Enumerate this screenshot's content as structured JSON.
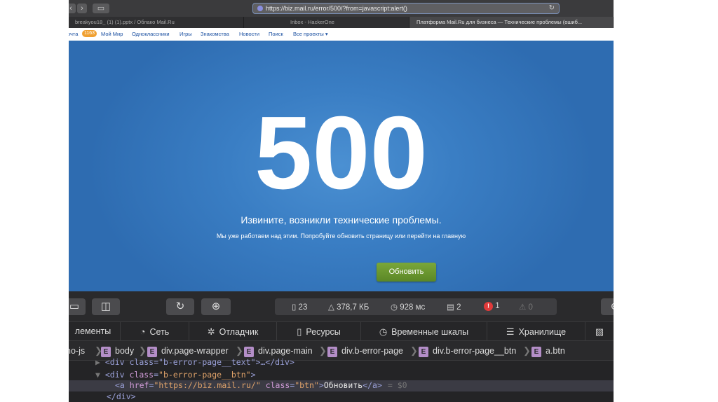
{
  "browser": {
    "url": "https://biz.mail.ru/error/500/?from=javascript:alert()",
    "tabs": [
      {
        "label": "breakyou18_ (1) (1).pptx / Облако Mail.Ru"
      },
      {
        "label": "Inbox - HackerOne"
      },
      {
        "label": "Платформа Mail.Ru для бизнеса — Технические проблемы (ошиб..."
      }
    ]
  },
  "portal_bar": {
    "mail_label": "очта",
    "mail_count": "1163",
    "links": [
      "Мой Мир",
      "Одноклассники",
      "Игры",
      "Знакомства",
      "Новости",
      "Поиск",
      "Все проекты ▾"
    ]
  },
  "error_page": {
    "code": "500",
    "headline": "Извините, возникли технические проблемы.",
    "subtext": "Мы уже работаем над этим. Попробуйте обновить страницу или перейти на главную",
    "button_label": "Обновить",
    "background_color": "#3a7ec4",
    "button_color": "#6b9a30"
  },
  "devtools": {
    "stats": {
      "resources": "23",
      "size": "378,7 КБ",
      "time": "928 мс",
      "logs": "2",
      "errors": "1",
      "warnings": "0"
    },
    "panel_tabs": [
      "лементы",
      "Сеть",
      "Отладчик",
      "Ресурсы",
      "Временные шкалы",
      "Хранилище"
    ],
    "breadcrumbs": [
      "no-js",
      "body",
      "div.page-wrapper",
      "div.page-main",
      "div.b-error-page",
      "div.b-error-page__btn",
      "a.btn"
    ],
    "dom": {
      "line1": "<div class=\"b-error-page__text\">…</div>",
      "line2_tag": "<div ",
      "line2_attr": "class",
      "line2_val": "\"b-error-page__btn\"",
      "line2_end": ">",
      "line3_open": "<a ",
      "line3_attr1": "href",
      "line3_val1": "\"https://biz.mail.ru/\"",
      "line3_attr2": "class",
      "line3_val2": "\"btn\"",
      "line3_text": "Обновить",
      "line3_close": "</a>",
      "line3_ref": "= $0",
      "line4": "</div>"
    }
  }
}
